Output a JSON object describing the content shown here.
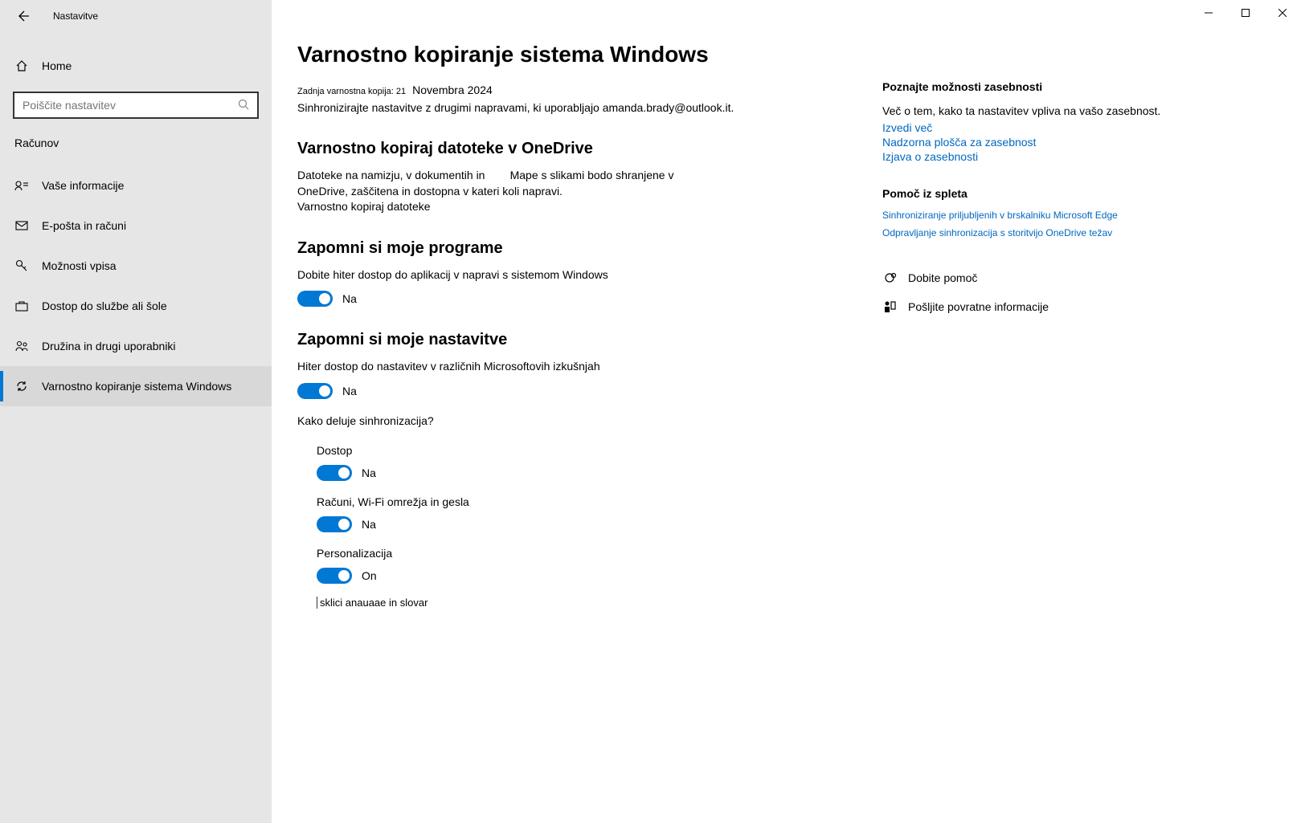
{
  "app": {
    "title": "Nastavitve"
  },
  "sidebar": {
    "home": "Home",
    "search_placeholder": "Poiščite nastavitev",
    "section": "Računov",
    "items": [
      {
        "label": "Vaše informacije"
      },
      {
        "label": "E-pošta in računi"
      },
      {
        "label": "Možnosti vpisa"
      },
      {
        "label": "Dostop do službe ali šole"
      },
      {
        "label": "Družina in drugi uporabniki"
      },
      {
        "label": "Varnostno kopiranje sistema Windows"
      }
    ]
  },
  "page": {
    "title": "Varnostno kopiranje sistema Windows",
    "last_backup_label": "Zadnja varnostna kopija: 21",
    "last_backup_value": "Novembra 2024",
    "sync_desc": "Sinhronizirajte nastavitve z drugimi napravami, ki uporabljajo amanda.brady@outlook.it."
  },
  "onedrive": {
    "title": "Varnostno kopiraj datoteke v OneDrive",
    "desc1": "Datoteke na namizju, v dokumentih in",
    "desc2": "Mape s slikami bodo shranjene v",
    "desc3": "OneDrive, zaščitena in dostopna v kateri koli napravi.",
    "link": "Varnostno kopiraj datoteke"
  },
  "apps": {
    "title": "Zapomni si moje programe",
    "desc": "Dobite hiter dostop do aplikacij v napravi s sistemom Windows",
    "state": "Na"
  },
  "settings": {
    "title": "Zapomni si moje nastavitve",
    "desc": "Hiter dostop do nastavitev v različnih Microsoftovih izkušnjah",
    "state": "Na",
    "how_link": "Kako deluje sinhronizacija?",
    "subs": [
      {
        "label": "Dostop",
        "state": "Na"
      },
      {
        "label": "Računi, Wi-Fi omrežja in gesla",
        "state": "Na"
      },
      {
        "label": "Personalizacija",
        "state": "On"
      }
    ],
    "dict_line": "sklici anauaae in slovar"
  },
  "right": {
    "privacy_title": "Poznajte možnosti zasebnosti",
    "privacy_desc": "Več o tem, kako ta nastavitev vpliva na vašo zasebnost.",
    "links": [
      "Izvedi več",
      "Nadzorna plošča za zasebnost",
      "Izjava o zasebnosti"
    ],
    "help_title": "Pomoč iz spleta",
    "help_links": [
      "Sinhroniziranje priljubljenih v brskalniku Microsoft Edge",
      "Odpravljanje sinhronizacija s storitvijo OneDrive težav"
    ],
    "support": [
      "Dobite pomoč",
      "Pošljite povratne informacije"
    ]
  }
}
